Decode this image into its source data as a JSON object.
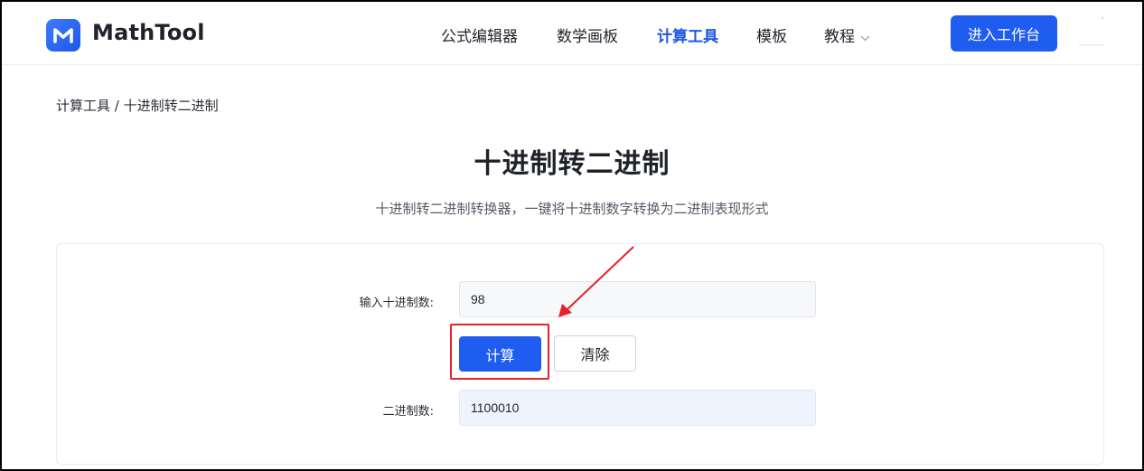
{
  "header": {
    "logo_text": "MathTool",
    "logo_icon": "m-logo-icon",
    "nav": [
      {
        "label": "公式编辑器",
        "active": false
      },
      {
        "label": "数学画板",
        "active": false
      },
      {
        "label": "计算工具",
        "active": true
      },
      {
        "label": "模板",
        "active": false
      },
      {
        "label": "教程",
        "active": false,
        "has_dropdown": true
      }
    ],
    "cta_label": "进入工作台"
  },
  "breadcrumb": "计算工具 / 十进制转二进制",
  "page": {
    "title": "十进制转二进制",
    "subtitle": "十进制转二进制转换器，一键将十进制数字转换为二进制表现形式"
  },
  "form": {
    "input_label": "输入十进制数:",
    "input_value": "98",
    "calc_label": "计算",
    "clear_label": "清除",
    "output_label": "二进制数:",
    "output_value": "1100010"
  },
  "colors": {
    "accent": "#1f5cf0",
    "annotation": "#e8202a"
  }
}
